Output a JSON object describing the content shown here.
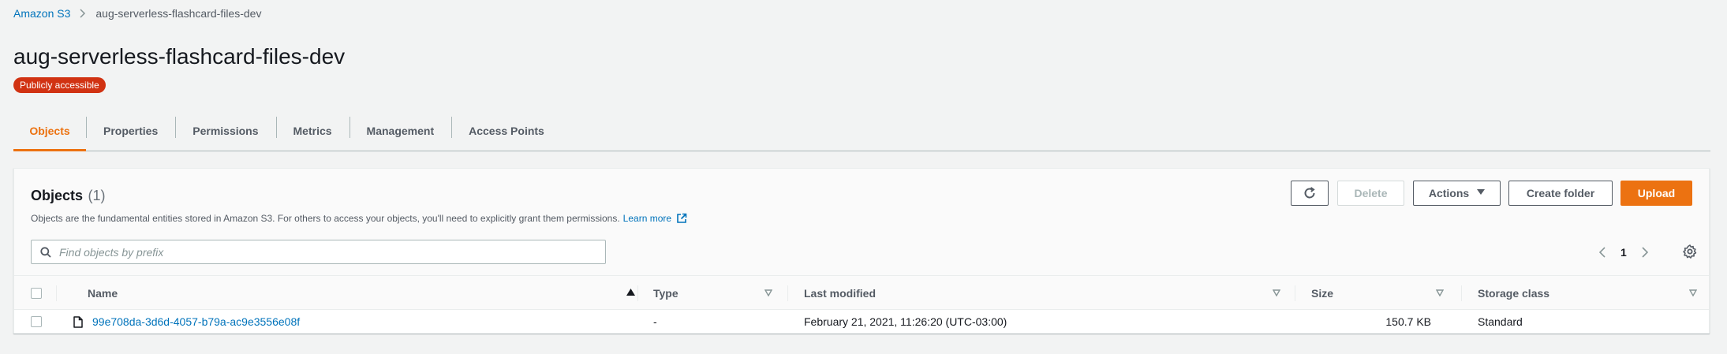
{
  "breadcrumb": {
    "root": "Amazon S3",
    "current": "aug-serverless-flashcard-files-dev"
  },
  "page": {
    "title": "aug-serverless-flashcard-files-dev",
    "badge": "Publicly accessible"
  },
  "tabs": [
    {
      "label": "Objects",
      "active": true
    },
    {
      "label": "Properties"
    },
    {
      "label": "Permissions"
    },
    {
      "label": "Metrics"
    },
    {
      "label": "Management"
    },
    {
      "label": "Access Points"
    }
  ],
  "objects": {
    "title": "Objects",
    "count": "(1)",
    "description": "Objects are the fundamental entities stored in Amazon S3. For others to access your objects, you'll need to explicitly grant them permissions.",
    "learn_more": "Learn more",
    "buttons": {
      "refresh_icon": "refresh-icon",
      "delete": "Delete",
      "actions": "Actions",
      "create_folder": "Create folder",
      "upload": "Upload"
    },
    "search": {
      "placeholder": "Find objects by prefix",
      "value": ""
    },
    "pagination": {
      "current_page": "1"
    },
    "columns": {
      "name": "Name",
      "type": "Type",
      "last_modified": "Last modified",
      "size": "Size",
      "storage_class": "Storage class"
    },
    "rows": [
      {
        "name": "99e708da-3d6d-4057-b79a-ac9e3556e08f",
        "type": "-",
        "last_modified": "February 21, 2021, 11:26:20 (UTC-03:00)",
        "size": "150.7 KB",
        "storage_class": "Standard"
      }
    ]
  },
  "colors": {
    "accent": "#ec7211",
    "link": "#0073bb",
    "badge": "#d13212"
  }
}
